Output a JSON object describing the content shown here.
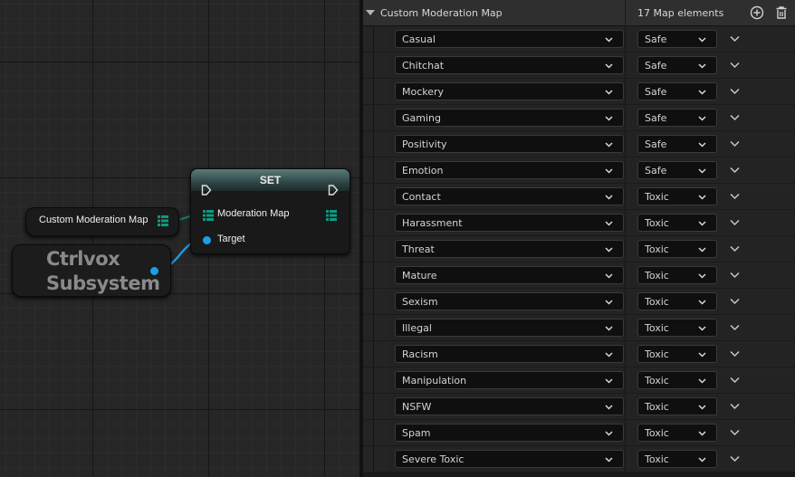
{
  "graph": {
    "variable_node": {
      "label": "Custom Moderation Map"
    },
    "subsystem_node": {
      "line1": "Ctrlvox",
      "line2": "Subsystem"
    },
    "set_node": {
      "title": "SET",
      "input_label": "Moderation Map",
      "target_label": "Target"
    },
    "colors": {
      "wire_map": "#0f7f6e",
      "wire_object": "#1aa0e8",
      "set_header": "#3d5b5b"
    }
  },
  "panel": {
    "property_name": "Custom Moderation Map",
    "element_count": "17 Map elements",
    "add_icon": "plus-circle-icon",
    "delete_icon": "trash-icon",
    "entries": [
      {
        "key": "Casual",
        "value": "Safe"
      },
      {
        "key": "Chitchat",
        "value": "Safe"
      },
      {
        "key": "Mockery",
        "value": "Safe"
      },
      {
        "key": "Gaming",
        "value": "Safe"
      },
      {
        "key": "Positivity",
        "value": "Safe"
      },
      {
        "key": "Emotion",
        "value": "Safe"
      },
      {
        "key": "Contact",
        "value": "Toxic"
      },
      {
        "key": "Harassment",
        "value": "Toxic"
      },
      {
        "key": "Threat",
        "value": "Toxic"
      },
      {
        "key": "Mature",
        "value": "Toxic"
      },
      {
        "key": "Sexism",
        "value": "Toxic"
      },
      {
        "key": "Illegal",
        "value": "Toxic"
      },
      {
        "key": "Racism",
        "value": "Toxic"
      },
      {
        "key": "Manipulation",
        "value": "Toxic"
      },
      {
        "key": "NSFW",
        "value": "Toxic"
      },
      {
        "key": "Spam",
        "value": "Toxic"
      },
      {
        "key": "Severe Toxic",
        "value": "Toxic"
      }
    ]
  }
}
